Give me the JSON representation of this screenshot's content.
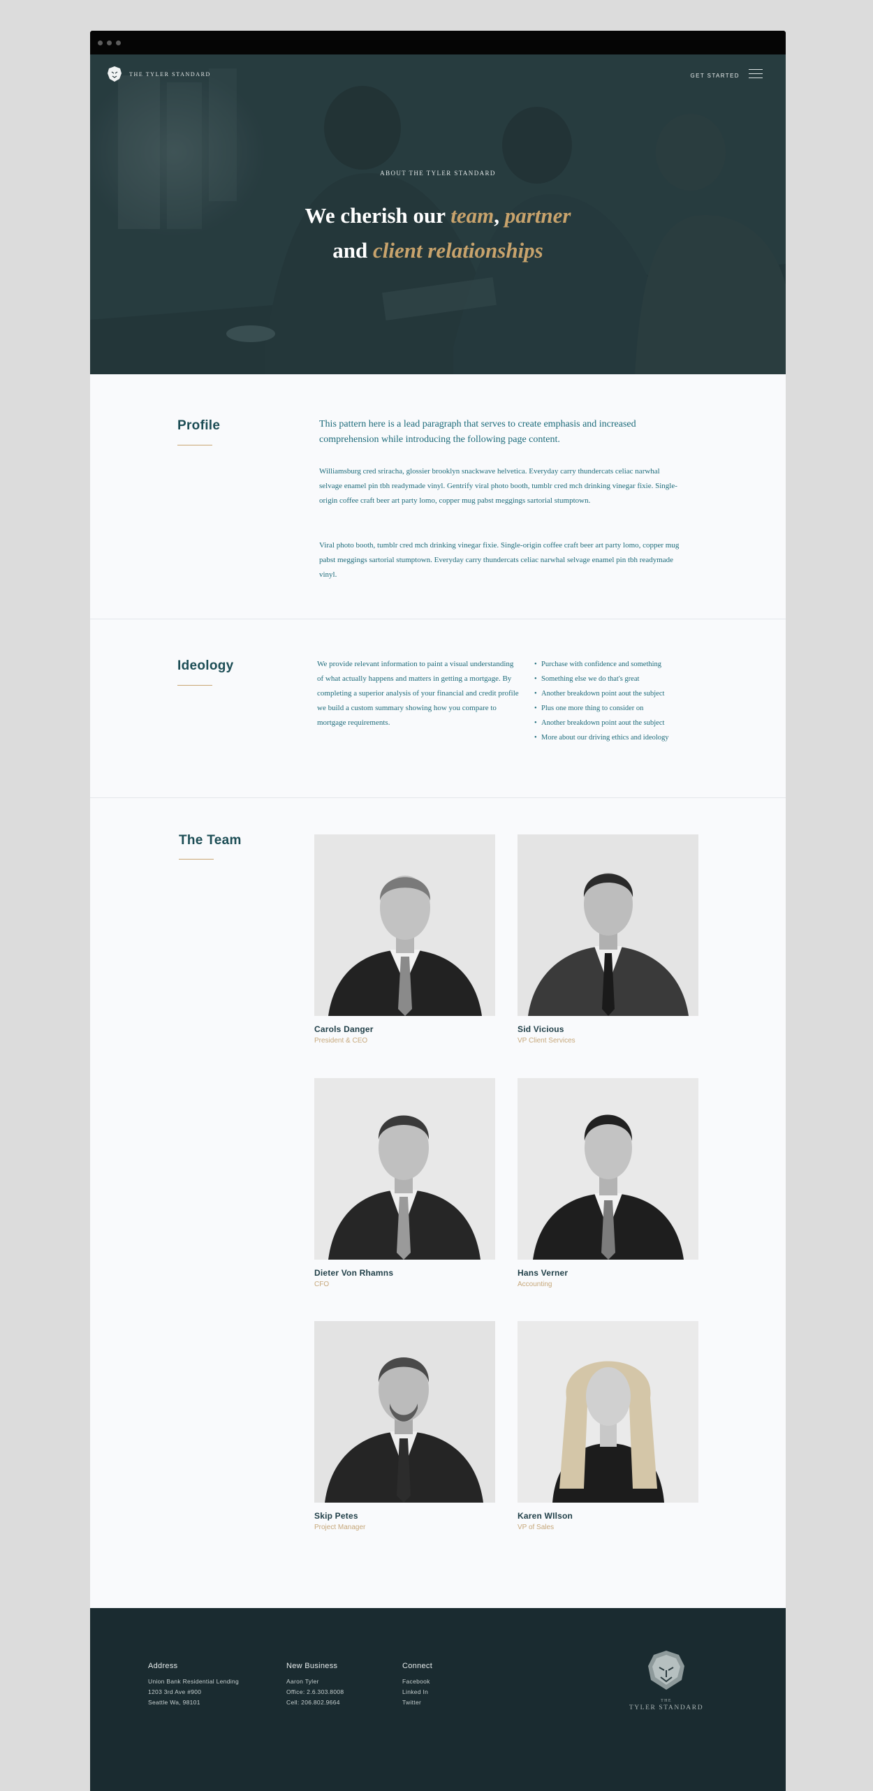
{
  "header": {
    "brand": "THE TYLER STANDARD",
    "cta": "GET STARTED"
  },
  "hero": {
    "eyebrow": "ABOUT THE TYLER STANDARD",
    "line1_a": "We cherish our ",
    "line1_em1": "team",
    "line1_comma": ", ",
    "line1_em2": "partner",
    "line2_a": "and ",
    "line2_em": "client relationships"
  },
  "profile": {
    "title": "Profile",
    "lead": "This pattern here is a lead paragraph that serves to create emphasis and increased comprehension while introducing the following page content.",
    "para1": "Williamsburg cred sriracha, glossier brooklyn snackwave helvetica. Everyday carry thundercats celiac narwhal selvage enamel pin tbh readymade vinyl. Gentrify viral photo booth, tumblr cred mch drinking vinegar  fixie. Single-origin coffee craft beer art party lomo, copper mug pabst meggings sartorial stumptown.",
    "para2": " Viral photo booth, tumblr cred mch drinking vinegar fixie. Single-origin coffee craft beer art party lomo, copper mug pabst meggings sartorial stumptown. Everyday carry thundercats celiac narwhal selvage enamel pin tbh readymade vinyl."
  },
  "ideology": {
    "title": "Ideology",
    "paragraph": "We provide relevant information to paint a visual understanding of what actually happens and matters in getting a mortgage. By completing a superior analysis of your financial and credit profile we build a custom summary showing how you compare to mortgage requirements.",
    "bullets": [
      "Purchase with confidence and something",
      "Something else we do that's great",
      "Another breakdown point aout the subject",
      "Plus one more thing to consider on",
      "Another breakdown point aout the subject",
      "More about our driving ethics and ideology"
    ]
  },
  "team": {
    "title": "The Team",
    "members": [
      {
        "name": "Carols Danger",
        "role": "President & CEO"
      },
      {
        "name": "Sid Vicious",
        "role": "VP Client Services"
      },
      {
        "name": "Dieter Von Rhamns",
        "role": "CFO"
      },
      {
        "name": "Hans Verner",
        "role": "Accounting"
      },
      {
        "name": "Skip Petes",
        "role": "Project Manager"
      },
      {
        "name": "Karen WIlson",
        "role": "VP of Sales"
      }
    ]
  },
  "footer": {
    "address": {
      "title": "Address",
      "lines": [
        "Union Bank Residential Lending",
        "1203 3rd Ave #900",
        "Seattle Wa, 98101"
      ]
    },
    "new_business": {
      "title": "New Business",
      "lines": [
        "Aaron Tyler",
        "Office: 2.6.303.8008",
        "Cell: 206.802.9664"
      ]
    },
    "connect": {
      "title": "Connect",
      "links": [
        "Facebook",
        "Linked In",
        "Twitter"
      ]
    },
    "logo_the": "THE",
    "logo_name": "TYLER STANDARD"
  }
}
